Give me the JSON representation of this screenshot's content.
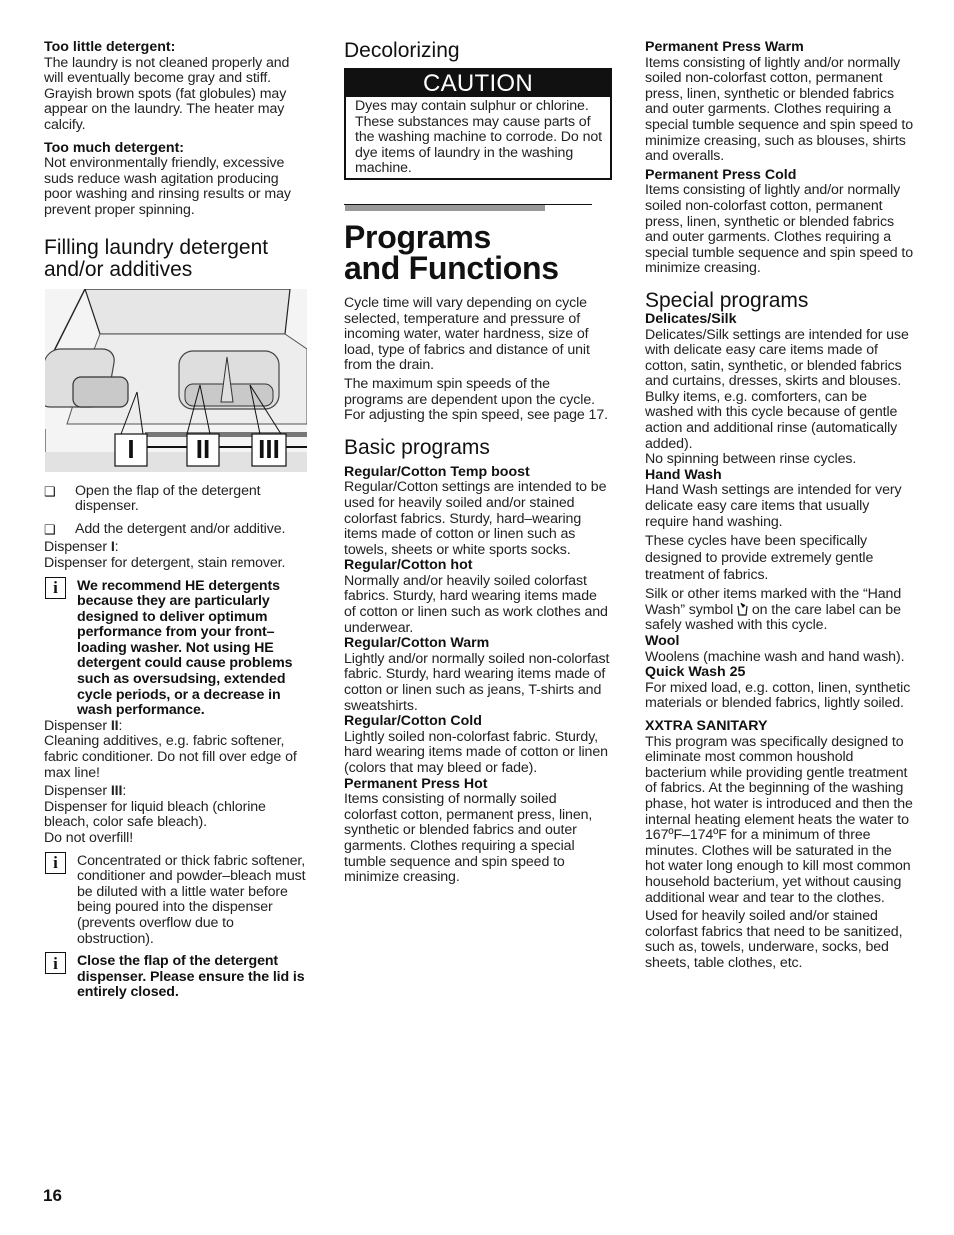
{
  "page_number": "16",
  "col1": {
    "too_little_title": "Too little detergent:",
    "too_little_text": "The laundry is not cleaned properly and will eventually become gray and stiff. Grayish brown spots (fat globules) may appear on the laundry. The heater may calcify.",
    "too_much_title": "Too much detergent:",
    "too_much_text": "Not environmentally friendly, excessive suds reduce wash agitation producing poor washing and rinsing results or may prevent proper spinning.",
    "filling_heading": "Filling laundry detergent and/or additives",
    "figure": {
      "description": "Detergent dispenser drawer with compartments",
      "labels": [
        "I",
        "II",
        "III"
      ]
    },
    "steps": [
      "Open the flap of the detergent dispenser.",
      "Add the detergent and/or additive."
    ],
    "checkbox_icon": "❑",
    "dispenser1_label": "Dispenser ",
    "dispenser1_num": "I",
    "dispenser1_text": "Dispenser for detergent, stain remover.",
    "note_icon": "i",
    "note1": "We recommend HE detergents because they are particularly designed to deliver optimum performance from your front–loading washer.  Not using HE detergent could cause problems such as oversudsing, extended cycle periods, or a decrease in wash performance.",
    "dispenser2_label": "Dispenser ",
    "dispenser2_num": "II",
    "dispenser2_text": "Cleaning additives, e.g. fabric softener, fabric conditioner. Do not fill over edge of max line!",
    "dispenser3_label": "Dispenser ",
    "dispenser3_num": "III",
    "dispenser3_text": "Dispenser for liquid bleach (chlorine bleach, color safe bleach).",
    "dispenser3_warn": "Do not overfill!",
    "note2": "Concentrated or thick fabric softener, conditioner and powder–bleach must be diluted with a little water before being poured into the dispenser (prevents overflow due to obstruction).",
    "note3": "Close the flap of the detergent dispenser.  Please ensure the lid is entirely closed."
  },
  "col2": {
    "decolorizing_heading": "Decolorizing",
    "caution_title": "CAUTION",
    "caution_text": "Dyes may contain sulphur or chlorine. These substances may cause parts of the washing machine to corrode. Do not dye items of laundry in the washing machine.",
    "section_title_line1": "Programs",
    "section_title_line2": "and Functions",
    "intro1": "Cycle time will vary depending on cycle selected, temperature and pressure of incoming water, water hardness, size of load, type of fabrics and distance of unit from the drain.",
    "intro2": "The maximum spin speeds of the programs are dependent upon the cycle. For adjusting the spin speed, see page 17.",
    "basic_heading": "Basic programs",
    "basic_programs": [
      {
        "name": "Regular/Cotton Temp boost",
        "text": "Regular/Cotton settings are intended to be used for heavily soiled and/or stained colorfast fabrics. Sturdy, hard–wearing items made of cotton or linen such as towels, sheets or white sports socks."
      },
      {
        "name": "Regular/Cotton hot",
        "text": "Normally and/or heavily soiled colorfast fabrics. Sturdy, hard wearing items made of cotton or linen such as work clothes and underwear."
      },
      {
        "name": "Regular/Cotton Warm",
        "text": "Lightly and/or normally soiled non-colorfast fabric. Sturdy, hard wearing items made of cotton or linen such as jeans, T-shirts and sweatshirts."
      },
      {
        "name": "Regular/Cotton Cold",
        "text": "Lightly soiled non-colorfast fabric. Sturdy, hard wearing items made of cotton or linen (colors that may bleed or fade)."
      },
      {
        "name": "Permanent Press Hot",
        "text": "Items consisting of normally soiled colorfast cotton, permanent press, linen, synthetic or blended fabrics and outer garments. Clothes requiring a special tumble sequence and spin speed to minimize creasing."
      }
    ]
  },
  "col3": {
    "pp_warm_name": "Permanent Press Warm",
    "pp_warm_text": "Items consisting of lightly and/or normally soiled non-colorfast cotton, permanent press, linen, synthetic or blended fabrics and outer garments. Clothes requiring a special tumble sequence and spin speed to minimize creasing, such as blouses, shirts and overalls.",
    "pp_cold_name": "Permanent Press Cold",
    "pp_cold_text": "Items consisting of lightly and/or normally soiled non-colorfast cotton, permanent press, linen, synthetic or blended fabrics and outer garments. Clothes requiring a special tumble sequence and spin speed to minimize creasing.",
    "special_heading": "Special programs",
    "delicates_name": "Delicates/Silk",
    "delicates_text1": "Delicates/Silk settings are intended for use with delicate easy care items made of cotton, satin, synthetic, or blended fabrics and curtains, dresses, skirts and blouses.",
    "delicates_text2": "Bulky items, e.g. comforters, can be washed with this cycle because of gentle action and additional rinse (automatically added).",
    "delicates_text3": "No spinning between rinse cycles.",
    "handwash_name": "Hand Wash",
    "handwash_text1": "Hand Wash settings are intended for very delicate easy care items that usually require hand washing.",
    "handwash_text2": "These cycles have been specifically designed to provide extremely gentle treatment of fabrics.",
    "handwash_text3a": "Silk or other items marked with the “Hand Wash” symbol ",
    "handwash_text3b": " on the care label can be safely washed with this cycle.",
    "wool_name": "Wool",
    "wool_text": "Woolens (machine wash and hand wash).",
    "quick_name": "Quick Wash 25",
    "quick_text": "For mixed load, e.g. cotton, linen, synthetic materials or blended fabrics, lightly soiled.",
    "sanitary_name": "XXTRA SANITARY",
    "sanitary_text1": "This program was specifically designed to eliminate most common houshold bacterium while providing gentle treatment of fabrics.  At the beginning of the washing phase, hot water is introduced and then the internal heating element heats the water to 167ºF–174ºF for a minimum of three minutes.  Clothes will be saturated in the hot water long enough to kill most common household bacterium, yet without causing additional wear and tear to the clothes.",
    "sanitary_text2": "Used for heavily soiled and/or stained colorfast fabrics that need to be sanitized, such as, towels, underware, socks, bed sheets, table clothes, etc."
  }
}
